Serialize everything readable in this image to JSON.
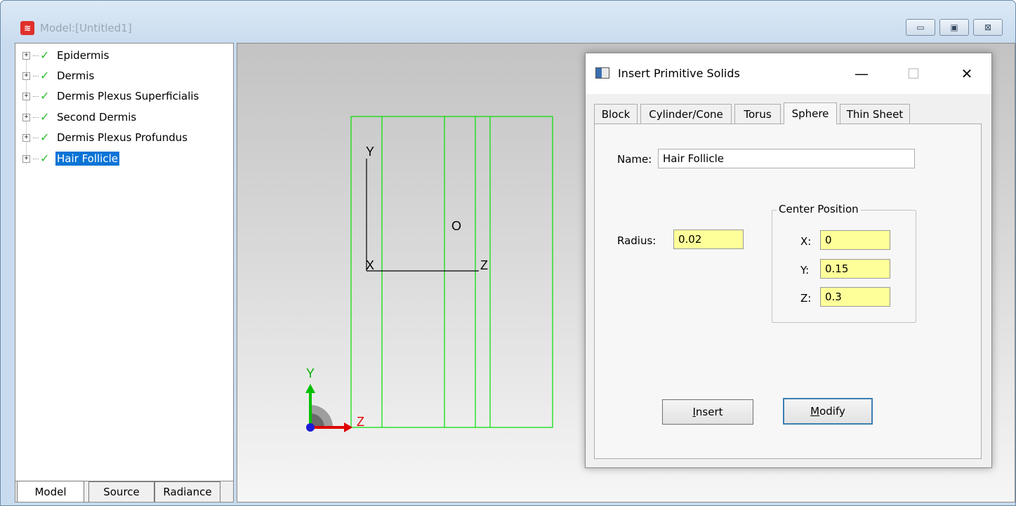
{
  "window": {
    "title": "Model:[Untitled1]",
    "controls": [
      "▭",
      "▣",
      "⊠"
    ]
  },
  "tree": {
    "items": [
      {
        "label": "Epidermis",
        "selected": false
      },
      {
        "label": "Dermis",
        "selected": false
      },
      {
        "label": "Dermis Plexus Superficialis",
        "selected": false
      },
      {
        "label": "Second Dermis",
        "selected": false
      },
      {
        "label": "Dermis Plexus Profundus",
        "selected": false
      },
      {
        "label": "Hair Follicle",
        "selected": true
      }
    ],
    "tabs": [
      "Model",
      "Source",
      "Radiance"
    ]
  },
  "viewport": {
    "axis_y": "Y",
    "axis_x": "X",
    "axis_z": "Z",
    "origin_label": "O",
    "gizmo_y": "Y",
    "gizmo_z": "Z",
    "outline_color": "#00e000"
  },
  "dialog": {
    "title": "Insert Primitive Solids",
    "minimize": "—",
    "maximize": "☐",
    "close": "✕",
    "tabs": [
      "Block",
      "Cylinder/Cone",
      "Torus",
      "Sphere",
      "Thin Sheet"
    ],
    "active_tab": "Sphere",
    "name_label": "Name:",
    "name_value": "Hair Follicle",
    "radius_label": "Radius:",
    "radius_value": "0.02",
    "center_group_title": "Center Position",
    "x_label": "X:",
    "x_value": "0",
    "y_label": "Y:",
    "y_value": "0.15",
    "z_label": "Z:",
    "z_value": "0.3",
    "insert_label": "Insert",
    "modify_label": "Modify"
  }
}
